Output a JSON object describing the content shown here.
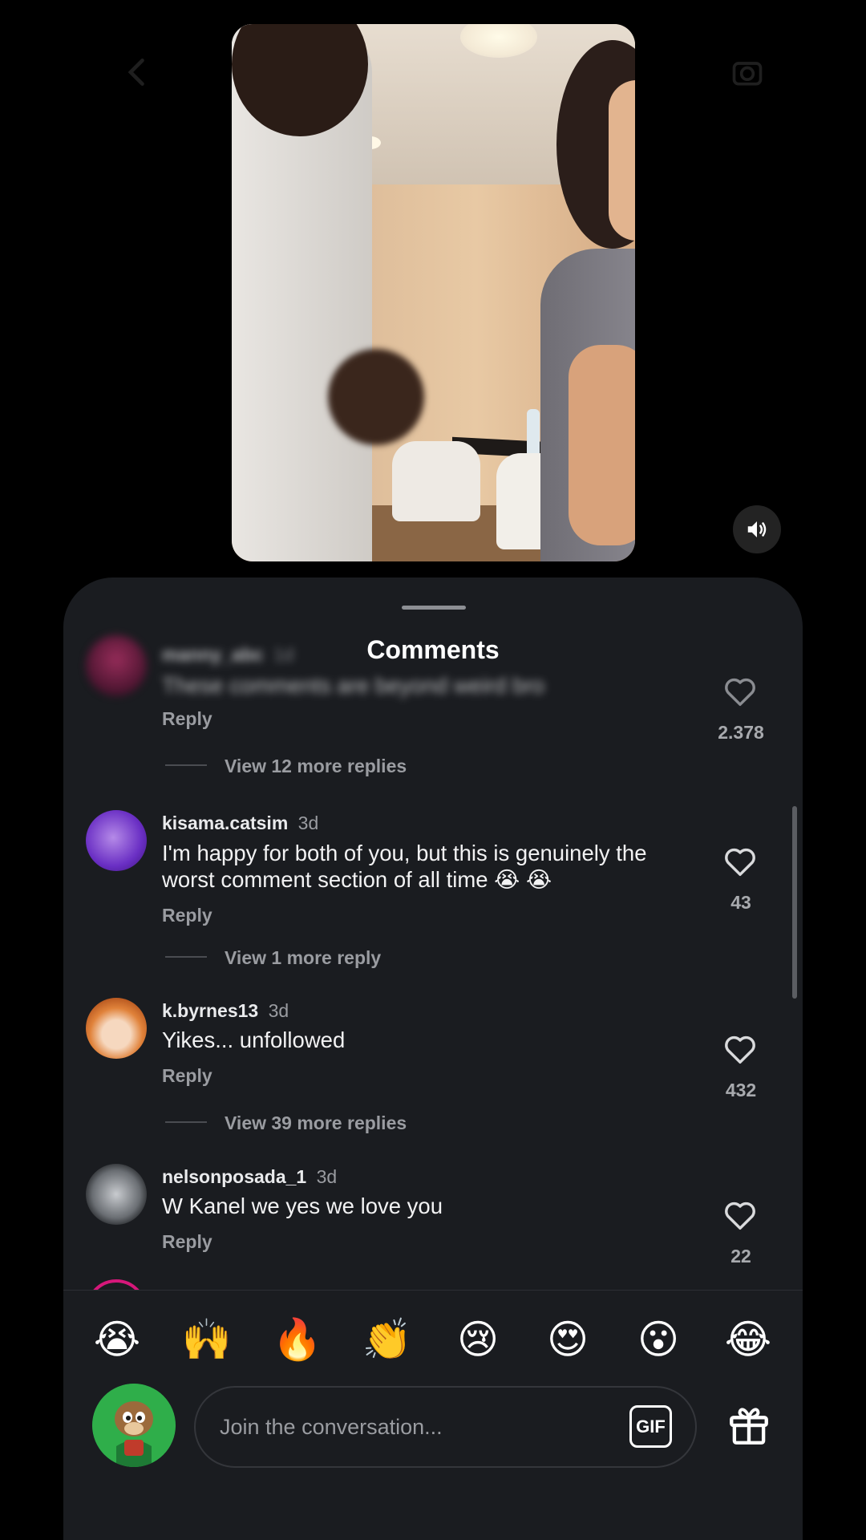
{
  "sheet": {
    "title": "Comments"
  },
  "comments": [
    {
      "username": "manny_abc",
      "time": "1d",
      "text": "These comments are beyond weird bro",
      "reply_label": "Reply",
      "likes": "2.378",
      "more_replies": "View 12 more replies"
    },
    {
      "username": "kisama.catsim",
      "time": "3d",
      "text": "I'm happy for both of you, but this is genuinely the worst comment section of all time 😭 😭",
      "reply_label": "Reply",
      "likes": "43",
      "more_replies": "View 1 more reply"
    },
    {
      "username": "k.byrnes13",
      "time": "3d",
      "text": "Yikes... unfollowed",
      "reply_label": "Reply",
      "likes": "432",
      "more_replies": "View 39 more replies"
    },
    {
      "username": "nelsonposada_1",
      "time": "3d",
      "text": "W Kanel we yes we love you",
      "reply_label": "Reply",
      "likes": "22"
    }
  ],
  "quick_reactions": [
    "😭",
    "🙌",
    "🔥",
    "👏",
    "😢",
    "😍",
    "😮",
    "😂"
  ],
  "composer": {
    "placeholder": "Join the conversation...",
    "gif_label": "GIF"
  },
  "icons": {
    "mute": "speaker-icon",
    "like": "heart-icon",
    "gift": "gift-icon",
    "gif": "gif-icon"
  },
  "colors": {
    "sheet_bg": "#1a1c20",
    "secondary_text": "#9a9ca1"
  }
}
